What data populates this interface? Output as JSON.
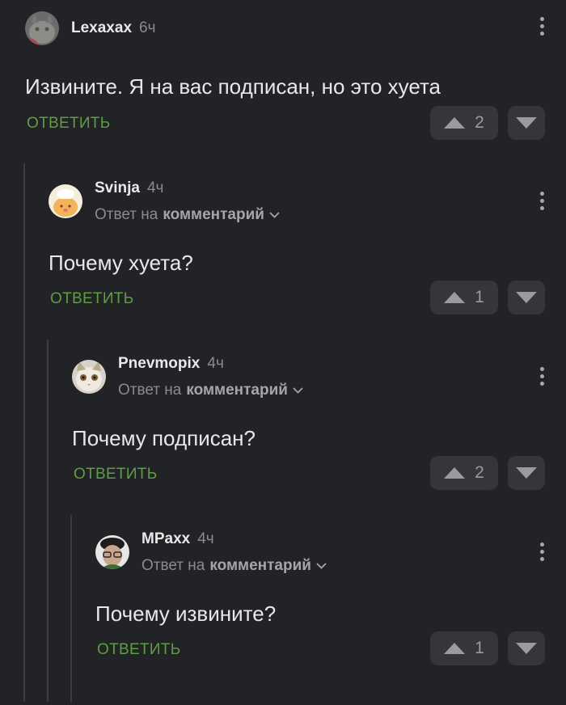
{
  "comments": [
    {
      "author": "Lexaxax",
      "time": "6ч",
      "text": "Извините. Я на вас подписан, но это хуета",
      "reply_label": "ОТВЕТИТЬ",
      "votes": "2",
      "reply_prefix": "",
      "reply_target": ""
    },
    {
      "author": "Svinja",
      "time": "4ч",
      "text": "Почему хуета?",
      "reply_label": "ОТВЕТИТЬ",
      "votes": "1",
      "reply_prefix": "Ответ на",
      "reply_target": "комментарий"
    },
    {
      "author": "Pnevmopix",
      "time": "4ч",
      "text": "Почему подписан?",
      "reply_label": "ОТВЕТИТЬ",
      "votes": "2",
      "reply_prefix": "Ответ на",
      "reply_target": "комментарий"
    },
    {
      "author": "MPaxx",
      "time": "4ч",
      "text": "Почему извините?",
      "reply_label": "ОТВЕТИТЬ",
      "votes": "1",
      "reply_prefix": "Ответ на",
      "reply_target": "комментарий"
    }
  ],
  "icons": {
    "menu": "more-vertical-icon",
    "up": "triangle-up-icon",
    "down": "triangle-down-icon",
    "expand": "chevron-down-icon"
  },
  "colors": {
    "background": "#222326",
    "accent_reply": "#5e9d42",
    "vote_button": "#34363b",
    "thread_line": "#3c3d41"
  }
}
